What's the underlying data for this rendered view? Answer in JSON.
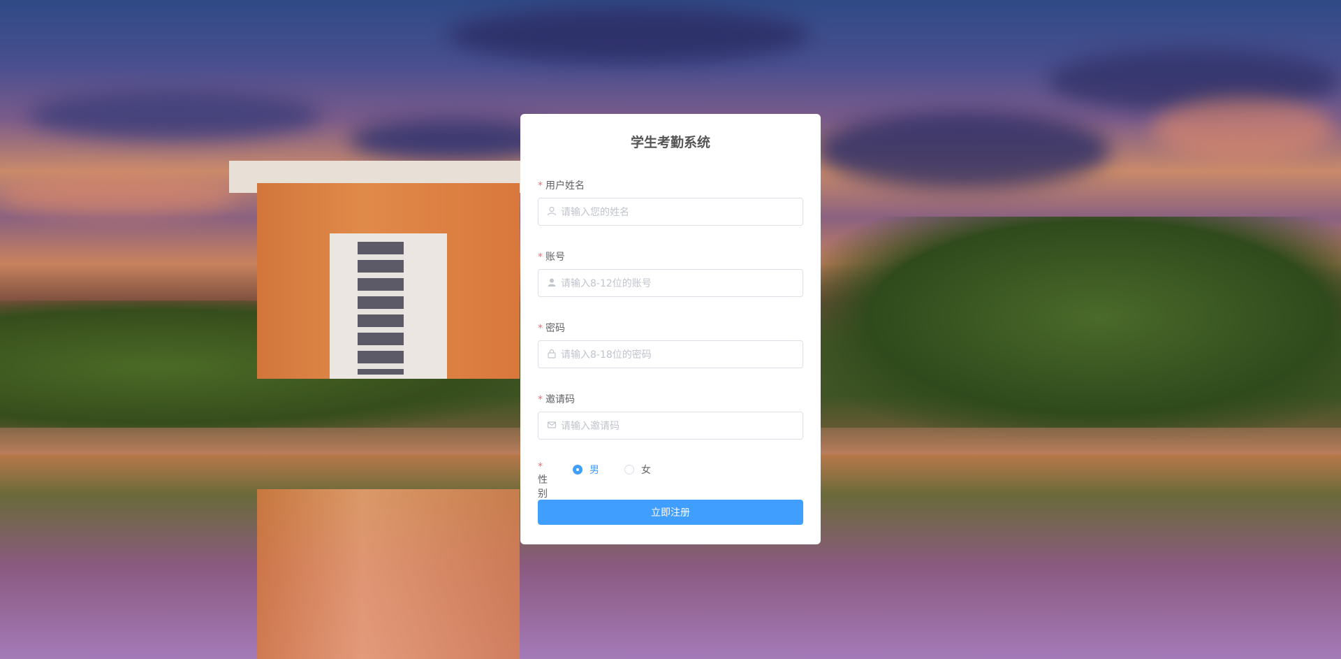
{
  "form": {
    "title": "学生考勤系统",
    "required_mark": "*",
    "fields": [
      {
        "label": "用户姓名",
        "placeholder": "请输入您的姓名",
        "icon": "user-outline-icon"
      },
      {
        "label": "账号",
        "placeholder": "请输入8-12位的账号",
        "icon": "user-solid-icon"
      },
      {
        "label": "密码",
        "placeholder": "请输入8-18位的密码",
        "icon": "lock-icon"
      },
      {
        "label": "邀请码",
        "placeholder": "请输入邀请码",
        "icon": "message-icon"
      }
    ],
    "gender": {
      "label": "性别",
      "options": [
        {
          "label": "男",
          "checked": true
        },
        {
          "label": "女",
          "checked": false
        }
      ]
    },
    "submit_label": "立即注册"
  },
  "colors": {
    "primary": "#409eff",
    "required": "#f56c6c"
  }
}
